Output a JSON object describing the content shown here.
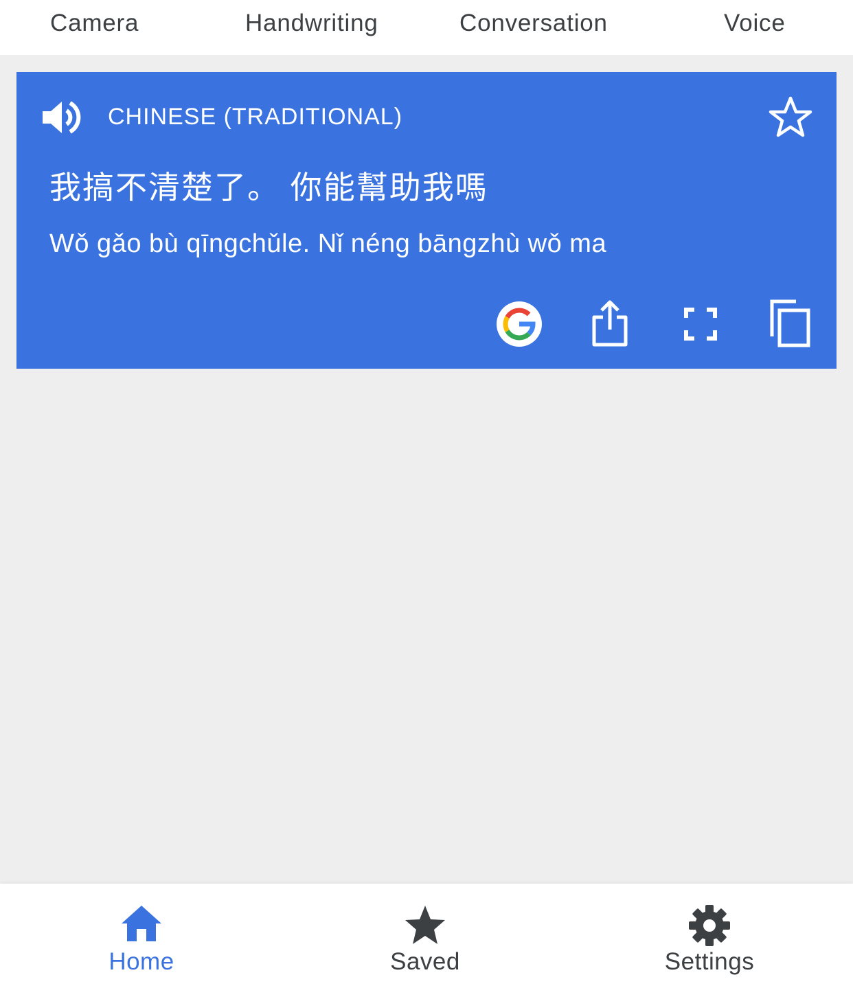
{
  "mode_tabs": [
    {
      "label": "Camera"
    },
    {
      "label": "Handwriting"
    },
    {
      "label": "Conversation"
    },
    {
      "label": "Voice"
    }
  ],
  "translation_card": {
    "language": "CHINESE (TRADITIONAL)",
    "translated_text": "我搞不清楚了。 你能幫助我嗎",
    "romanization": "Wǒ gǎo bù qīngchǔle. Nǐ néng bāngzhù wǒ ma",
    "background_color": "#3a73e0",
    "icons": {
      "speaker": "speaker-icon",
      "star": "star-outline-icon",
      "google": "google-icon",
      "share": "share-icon",
      "fullscreen": "fullscreen-icon",
      "copy": "copy-icon"
    }
  },
  "bottom_nav": {
    "items": [
      {
        "label": "Home",
        "icon": "home-icon",
        "active": true
      },
      {
        "label": "Saved",
        "icon": "star-icon",
        "active": false
      },
      {
        "label": "Settings",
        "icon": "gear-icon",
        "active": false
      }
    ],
    "active_color": "#3a73e0",
    "inactive_color": "#3c4043"
  }
}
